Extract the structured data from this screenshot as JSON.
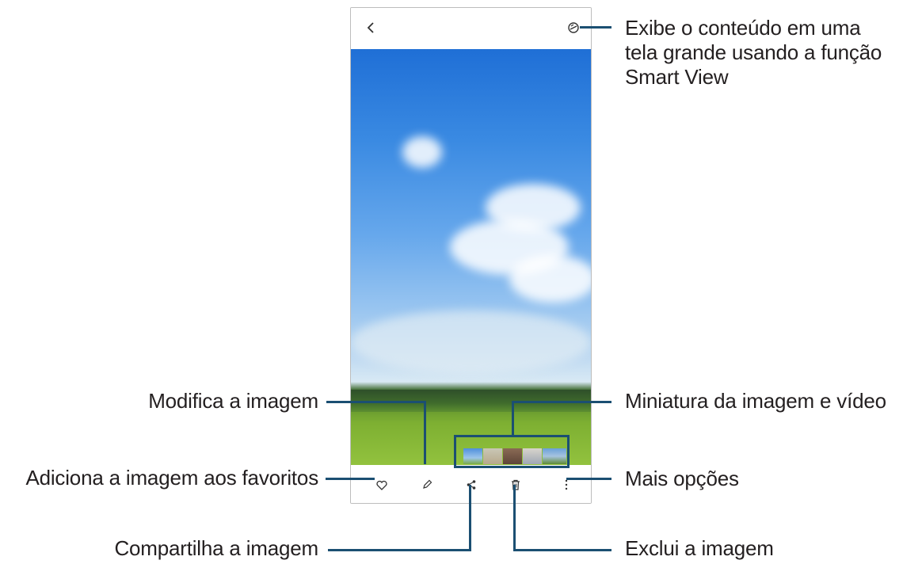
{
  "callouts": {
    "smart_view": "Exibe o conteúdo em uma tela grande usando a função Smart View",
    "smart_view_lines": [
      "Exibe o conteúdo em uma",
      "tela grande usando a função",
      "Smart View"
    ],
    "edit": "Modifica a imagem",
    "thumbnails": "Miniatura da imagem e vídeo",
    "favorites": "Adiciona a imagem aos favoritos",
    "more": "Mais opções",
    "share": "Compartilha a imagem",
    "delete": "Exclui a imagem"
  },
  "icons": {
    "back": "chevron-left-icon",
    "smart_view": "smart-view-icon",
    "favorite": "heart-icon",
    "edit": "pencil-icon",
    "share": "share-icon",
    "delete": "trash-icon",
    "more": "more-vertical-icon"
  },
  "colors": {
    "leader_line": "#1b4f72",
    "text": "#231f20",
    "frame_border": "#bdbdbd"
  }
}
